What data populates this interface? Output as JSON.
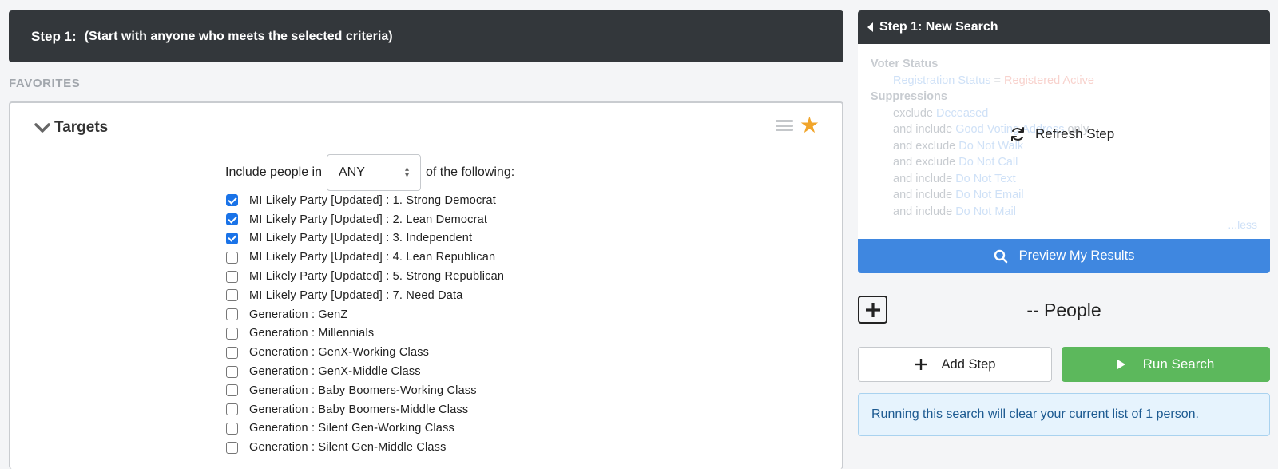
{
  "step": {
    "label": "Step 1:",
    "description": "(Start with anyone who meets the selected criteria)"
  },
  "favorites_label": "FAVORITES",
  "targets": {
    "title": "Targets",
    "include_prefix": "Include people in",
    "include_mode": "ANY",
    "include_suffix": "of the following:",
    "options": [
      {
        "label": "MI Likely Party [Updated] : 1. Strong Democrat",
        "checked": true
      },
      {
        "label": "MI Likely Party [Updated] : 2. Lean Democrat",
        "checked": true
      },
      {
        "label": "MI Likely Party [Updated] : 3. Independent",
        "checked": true
      },
      {
        "label": "MI Likely Party [Updated] : 4. Lean Republican",
        "checked": false
      },
      {
        "label": "MI Likely Party [Updated] : 5. Strong Republican",
        "checked": false
      },
      {
        "label": "MI Likely Party [Updated] : 7. Need Data",
        "checked": false
      },
      {
        "label": "Generation : GenZ",
        "checked": false
      },
      {
        "label": "Generation : Millennials",
        "checked": false
      },
      {
        "label": "Generation : GenX-Working Class",
        "checked": false
      },
      {
        "label": "Generation : GenX-Middle Class",
        "checked": false
      },
      {
        "label": "Generation : Baby Boomers-Working Class",
        "checked": false
      },
      {
        "label": "Generation : Baby Boomers-Middle Class",
        "checked": false
      },
      {
        "label": "Generation : Silent Gen-Working Class",
        "checked": false
      },
      {
        "label": "Generation : Silent Gen-Middle Class",
        "checked": false
      }
    ]
  },
  "right_panel": {
    "title": "Step 1: New Search",
    "criteria": {
      "voter_status": "Voter Status",
      "reg_key": "Registration Status",
      "reg_eq": " = ",
      "reg_val": "Registered Active",
      "suppressions": "Suppressions",
      "lines": [
        {
          "prefix": "exclude ",
          "value": "Deceased",
          "suffix": ""
        },
        {
          "prefix": "and include ",
          "value": "Good Voting Address",
          "suffix": " only"
        },
        {
          "prefix": "and exclude ",
          "value": "Do Not Walk",
          "suffix": ""
        },
        {
          "prefix": "and exclude ",
          "value": "Do Not Call",
          "suffix": ""
        },
        {
          "prefix": "and include ",
          "value": "Do Not Text",
          "suffix": ""
        },
        {
          "prefix": "and include ",
          "value": "Do Not Email",
          "suffix": ""
        },
        {
          "prefix": "and include ",
          "value": "Do Not Mail",
          "suffix": ""
        }
      ],
      "less_link": "...less"
    },
    "refresh_label": "Refresh Step",
    "preview_label": "Preview My Results",
    "people_count": "-- People",
    "add_step_label": "Add Step",
    "run_search_label": "Run Search",
    "notice": "Running this search will clear your current list of 1 person."
  },
  "colors": {
    "header_bg": "#33373b",
    "preview_blue": "#3f87e0",
    "run_green": "#5cb85c",
    "star": "#f1a52b",
    "checkbox_blue": "#1a73e8"
  }
}
